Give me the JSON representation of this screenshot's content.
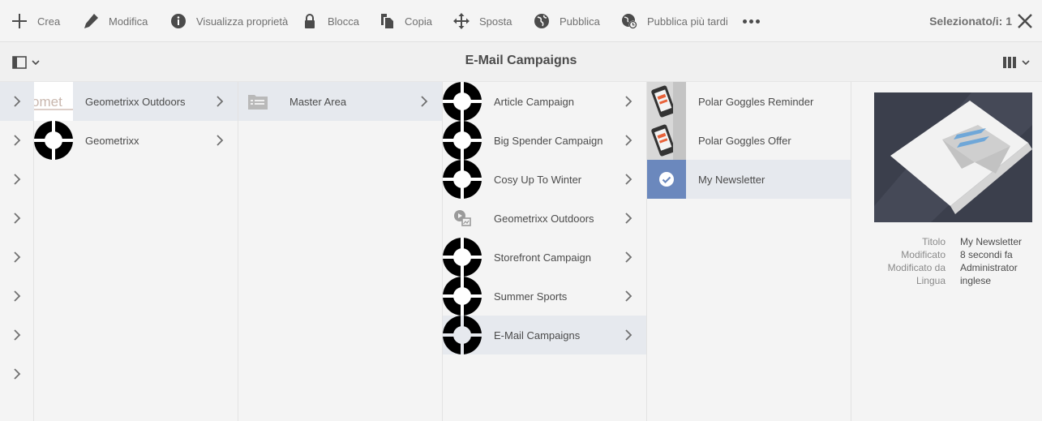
{
  "actionbar": {
    "create": "Crea",
    "edit": "Modifica",
    "properties": "Visualizza proprietà",
    "lock": "Blocca",
    "copy": "Copia",
    "move": "Sposta",
    "publish": "Pubblica",
    "publish_later": "Pubblica più tardi",
    "selected": "Selezionato/i: 1"
  },
  "title": "E-Mail Campaigns",
  "columns": {
    "col1": [
      {
        "label": "Geometrixx Outdoors",
        "logo_text": "omet"
      },
      {
        "label": "Geometrixx"
      }
    ],
    "col2": [
      {
        "label": "Master Area"
      }
    ],
    "col3": [
      {
        "label": "Article Campaign"
      },
      {
        "label": "Big Spender Campaign"
      },
      {
        "label": "Cosy Up To Winter"
      },
      {
        "label": "Geometrixx Outdoors"
      },
      {
        "label": "Storefront Campaign"
      },
      {
        "label": "Summer Sports"
      },
      {
        "label": "E-Mail Campaigns"
      }
    ],
    "col4": [
      {
        "label": "Polar Goggles Reminder"
      },
      {
        "label": "Polar Goggles Offer"
      },
      {
        "label": "My Newsletter"
      }
    ]
  },
  "metadata": {
    "title_key": "Titolo",
    "title_value": "My Newsletter",
    "modified_key": "Modificato",
    "modified_value": "8 secondi fa",
    "modified_by_key": "Modificato da",
    "modified_by_value": "Administrator",
    "language_key": "Lingua",
    "language_value": "inglese"
  },
  "colors": {
    "background": "#f4f4f4",
    "selected_row": "#e6e9ee",
    "text": "#4b4b4b",
    "muted": "#707070"
  }
}
